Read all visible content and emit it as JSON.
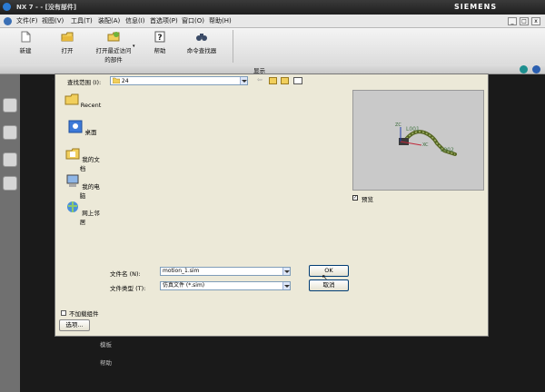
{
  "window": {
    "title": "NX 7 - - [没有部件]",
    "brand": "SIEMENS",
    "controls": [
      "_",
      "□",
      "x"
    ]
  },
  "menu": {
    "items": [
      "文件(F)",
      "视图(V)",
      "工具(T)",
      "装配(A)",
      "信息(I)",
      "首选项(P)",
      "窗口(O)",
      "帮助(H)"
    ]
  },
  "toolbar": {
    "new_label": "新建",
    "open_label": "打开",
    "recent_label_1": "打开最近访问",
    "recent_label_2": "的部件",
    "help_label": "帮助",
    "finder_label": "命令查找器"
  },
  "group_label": "显示",
  "dialog": {
    "lookin_label": "查找范围 (I):",
    "lookin_value": "24",
    "places": [
      {
        "label": "Recent"
      },
      {
        "label": "桌面"
      },
      {
        "label": "我的文档"
      },
      {
        "label": "我的电脑"
      },
      {
        "label": "网上邻居"
      }
    ],
    "filename_label": "文件名 (N):",
    "filename_value": "motion_1.sim",
    "filetype_label": "文件类型 (T):",
    "filetype_value": "仿真文件 (*.sim)",
    "ok_label": "OK",
    "cancel_label": "取消",
    "preview_label": "预览",
    "no_load_label": "不加载组件",
    "options_label": "选项..."
  },
  "preview_labels": {
    "l001": "L001",
    "l002": "L002",
    "zc": "ZC",
    "xc": "XC"
  },
  "stage_links": [
    "模板",
    "帮助"
  ]
}
